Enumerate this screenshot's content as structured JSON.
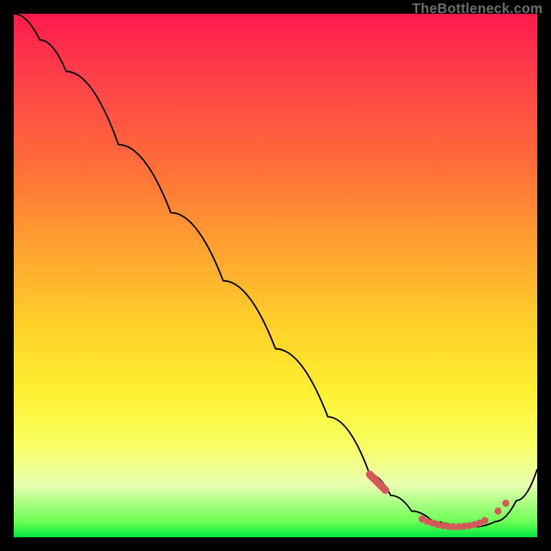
{
  "attribution": "TheBottleneck.com",
  "chart_data": {
    "type": "line",
    "title": "",
    "xlabel": "",
    "ylabel": "",
    "x_range": [
      0,
      100
    ],
    "y_range": [
      0,
      100
    ],
    "series": [
      {
        "name": "performance-curve",
        "x": [
          0,
          5,
          10,
          20,
          30,
          40,
          50,
          60,
          68,
          72,
          76,
          80,
          84,
          88,
          92,
          96,
          100
        ],
        "y": [
          100,
          95,
          89,
          75,
          62,
          49,
          36,
          23,
          12,
          8,
          5,
          3,
          2,
          2,
          3,
          7,
          13
        ]
      },
      {
        "name": "highlight-dots",
        "x": [
          68,
          69.5,
          71,
          78,
          79,
          80,
          81,
          82,
          83,
          84,
          85,
          86,
          87,
          88,
          89,
          90,
          92.5,
          94
        ],
        "y": [
          12,
          10.5,
          9,
          3.5,
          3,
          2.7,
          2.4,
          2.2,
          2.1,
          2.0,
          2.0,
          2.1,
          2.2,
          2.4,
          2.7,
          3.2,
          5,
          6.5
        ]
      }
    ],
    "colors": {
      "curve": "#000000",
      "dots": "#d35a5a",
      "gradient_top": "#ff1a4d",
      "gradient_mid": "#ffd22a",
      "gradient_bottom": "#00e840"
    }
  }
}
